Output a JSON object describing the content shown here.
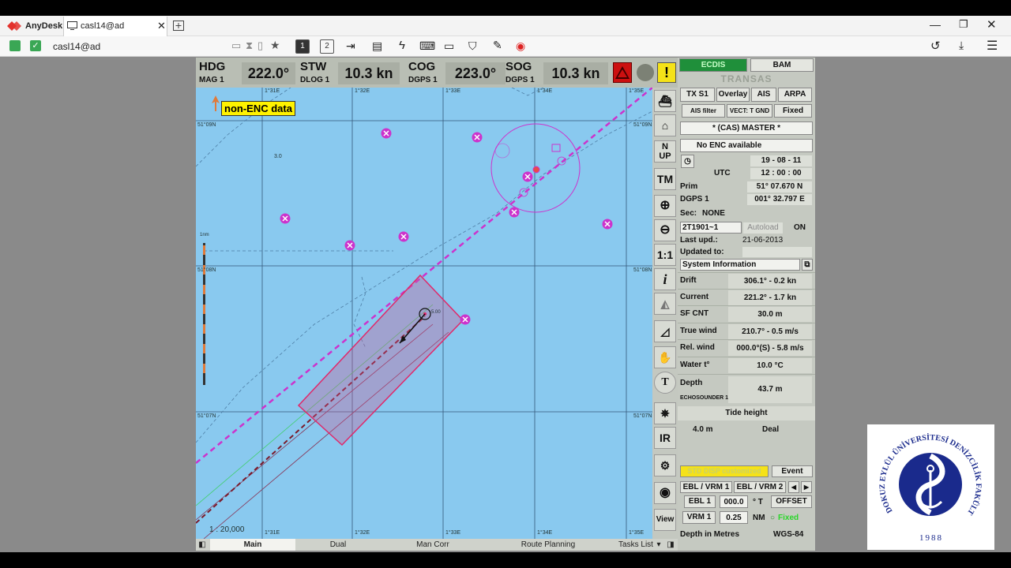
{
  "anydesk": {
    "app_name": "AnyDesk",
    "tab_label": "casl14@ad",
    "address": "casl14@ad",
    "toolbar_numbers": [
      "1",
      "2"
    ]
  },
  "header": {
    "hdg_label": "HDG",
    "hdg_sub": "MAG 1",
    "hdg_value": "222.0°",
    "stw_label": "STW",
    "stw_sub": "DLOG 1",
    "stw_value": "10.3 kn",
    "cog_label": "COG",
    "cog_sub": "DGPS 1",
    "cog_value": "223.0°",
    "sog_label": "SOG",
    "sog_sub": "DGPS 1",
    "sog_value": "10.3 kn",
    "warning_mark": "!"
  },
  "chart": {
    "non_enc_label": "non-ENC data",
    "scale": "1 : 20,000",
    "lat_labels": [
      "51°09N",
      "51°08N",
      "51°07N"
    ],
    "lon_labels": [
      "1°31E",
      "1°32E",
      "1°33E",
      "1°34E",
      "1°35E"
    ],
    "depth_label": "3.0",
    "scale_bar_label": "1nm",
    "own_ship_label": "5.00",
    "colors": {
      "sea": "#89c9ef",
      "route": "#cc33cc",
      "safety_zone": "#e0286a",
      "grid": "#3a5a7a"
    }
  },
  "right_icons": {
    "nup": "N UP",
    "tm": "TM",
    "one_to_one": "1:1",
    "info": "i",
    "t": "T",
    "ir": "IR",
    "view": "View"
  },
  "bottom_tabs": [
    "Main",
    "Dual",
    "Man Corr",
    "Route Planning",
    "Tasks List"
  ],
  "panel": {
    "ecdis": "ECDIS",
    "bam": "BAM",
    "brand": "TRANSAS",
    "tx_s1": "TX S1",
    "overlay": "Overlay",
    "ais": "AIS",
    "arpa": "ARPA",
    "ais_filter": "AIS filter",
    "vect": "VECT: T GND",
    "fixed": "Fixed",
    "cas_master": "* (CAS) MASTER *",
    "no_enc": "No ENC available",
    "date": "19 - 08 - 11",
    "utc": "UTC",
    "time": "12 : 00 : 00",
    "prim_label": "Prim",
    "prim_value": "51° 07.670 N",
    "dgps_label": "DGPS 1",
    "dgps_value": "001° 32.797 E",
    "sec_label": "Sec:",
    "sec_value": "NONE",
    "chart_id": "2T1901~1",
    "autoload": "Autoload",
    "on": "ON",
    "last_upd_label": "Last upd.:",
    "last_upd_value": "21-06-2013",
    "updated_to_label": "Updated to:",
    "system_info": "System Information",
    "rows": [
      {
        "k": "Drift",
        "v": "306.1° - 0.2 kn"
      },
      {
        "k": "Current",
        "v": "221.2° - 1.7 kn"
      },
      {
        "k": "SF CNT",
        "v": "30.0 m"
      },
      {
        "k": "True wind",
        "v": "210.7° - 0.5 m/s"
      },
      {
        "k": "Rel. wind",
        "v": "000.0°(S) - 5.8 m/s"
      },
      {
        "k": "Water t°",
        "v": "10.0 °C"
      }
    ],
    "depth_label": "Depth",
    "depth_sub": "ECHOSOUNDER 1",
    "depth_value": "43.7 m",
    "tide_height": "Tide height",
    "tide_value": "4.0 m",
    "tide_state": "Deal",
    "std_disp": "STD DISP customized",
    "event": "Event",
    "ebl_vrm1": "EBL / VRM 1",
    "ebl_vrm2": "EBL / VRM 2",
    "ebl1": "EBL 1",
    "ebl1_value": "000.0",
    "ebl_unit": "° T",
    "offset": "OFFSET",
    "vrm1": "VRM 1",
    "vrm1_value": "0.25",
    "vrm_unit": "NM",
    "floated": "Fixed",
    "depth_in": "Depth in Metres",
    "datum": "WGS-84"
  },
  "logo": {
    "text": "DOKUZ EYLÜL ÜNİVERSİTESİ DENİZCİLİK FAKÜLTESİ",
    "year": "1988"
  }
}
